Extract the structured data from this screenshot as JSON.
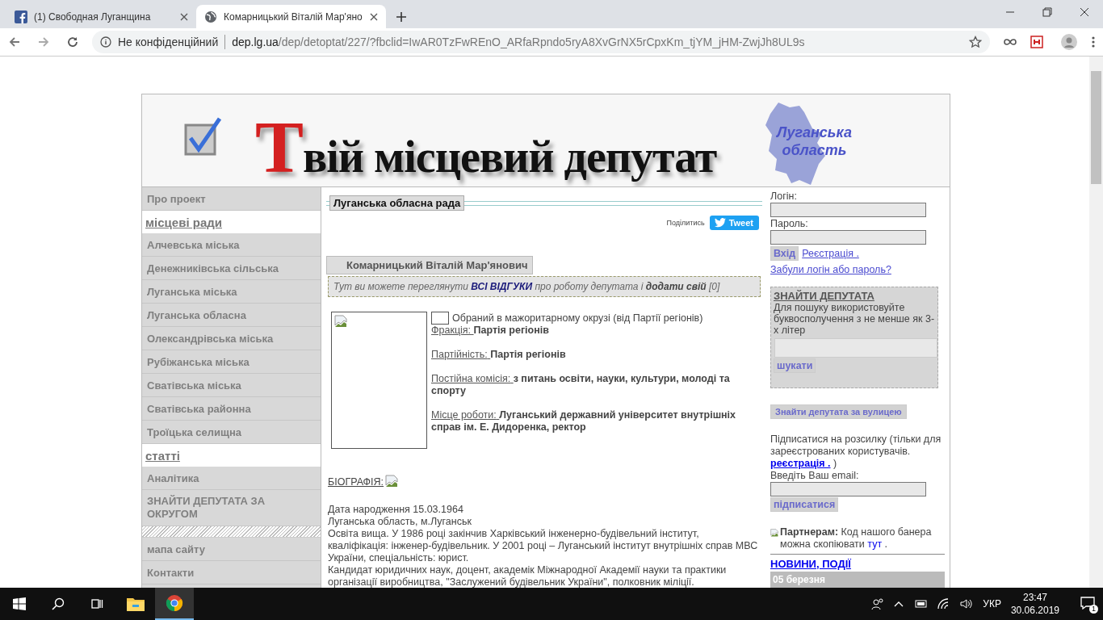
{
  "browser": {
    "tabs": [
      {
        "title": "(1) Свободная Луганщина",
        "selected": false,
        "kind": "facebook"
      },
      {
        "title": "Комарницький Віталій Мар'яно",
        "selected": true,
        "kind": "globe"
      }
    ],
    "security": "Не конфіденційний",
    "host": "dep.lg.ua",
    "path": "/dep/detoptat/227/?fbclid=IwAR0TzFwREnO_ARfaRpndo5ryA8XvGrNX5rCpxKm_tjYM_jHM-ZwjJh8UL9s"
  },
  "header": {
    "title_initial": "Т",
    "title_rest": "вій місцевий депутат",
    "region": [
      "Луганська",
      "область"
    ]
  },
  "sidebar": [
    {
      "kind": "item",
      "label": "Про проект"
    },
    {
      "kind": "section",
      "label": "місцеві ради"
    },
    {
      "kind": "item",
      "label": "Алчевська міська"
    },
    {
      "kind": "item",
      "label": "Денежниківська сільська"
    },
    {
      "kind": "item",
      "label": "Луганська міська"
    },
    {
      "kind": "item",
      "label": "Луганська обласна"
    },
    {
      "kind": "item",
      "label": "Олександрівська міська"
    },
    {
      "kind": "item",
      "label": "Рубіжанська міська"
    },
    {
      "kind": "item",
      "label": "Сватівська міська"
    },
    {
      "kind": "item",
      "label": "Сватівська районна"
    },
    {
      "kind": "item",
      "label": "Троїцька селищна"
    },
    {
      "kind": "section",
      "label": "статті"
    },
    {
      "kind": "item",
      "label": "Аналітика"
    },
    {
      "kind": "item",
      "label": "ЗНАЙТИ ДЕПУТАТА ЗА ОКРУГОМ"
    },
    {
      "kind": "hatch"
    },
    {
      "kind": "item",
      "label": "мапа сайту"
    },
    {
      "kind": "item",
      "label": "Контакти"
    }
  ],
  "content": {
    "council": "Луганська обласна рада",
    "share_label": "Поділитись",
    "tweet": "Tweet",
    "deputy_name": "Комарницький Віталій Мар'янович",
    "reviews": {
      "before": "Тут ви можете переглянути",
      "all_link": "ВСІ ВІДГУКИ",
      "middle": "про роботу депутата і",
      "add_link": "додати свій",
      "count": "[0]"
    },
    "elected": "Обраний в мажоритарному окрузі (від Партії регіонів)",
    "facts": [
      {
        "label": "Фракція:",
        "value": "Партія регіонів"
      },
      {
        "label": "Партійність:",
        "value": "Партія регіонів"
      },
      {
        "label": "Постійна комісія:",
        "value": "з питань освіти, науки, культури, молоді та спорту"
      },
      {
        "label": "Місце роботи:",
        "value": "Луганський державний університет внутрішніх справ ім. Е. Дидоренка, ректор"
      }
    ],
    "biography_heading": "БІОГРАФІЯ:",
    "biography": [
      "Дата народження 15.03.1964",
      "Луганська область, м.Луганськ",
      "Освіта вища. У 1986 році закінчив Харківський інженерно-будівельний інститут, кваліфікація: інженер-будівельник. У 2001 році – Луганський інститут внутрішніх справ МВС України, спеціальність: юрист.",
      "Кандидат юридичних наук, доцент, академік Міжнародної Академії науки та практики організації виробництва,  \"Заслужений будівельник України\", полковник міліції."
    ]
  },
  "right": {
    "login_label": "Логін:",
    "password_label": "Пароль:",
    "submit": "Вхід",
    "register": "Реєстрація .",
    "forgot": "Забули логін або пароль?",
    "search": {
      "title": "ЗНАЙТИ ДЕПУТАТА",
      "hint": "Для пошуку використовуйте буквосполучення з не менше як 3-х літер",
      "button": "шукати"
    },
    "street_button": "Знайти депутата за вулицею",
    "subscribe": {
      "text": "Підписатися на розсилку (тільки для зареєстрованих користувачів.",
      "link": "реєстрація .",
      "close": ")",
      "email_label": "Введіть Ваш email:",
      "button": "підписатися"
    },
    "partners": {
      "text": "**Партнерам:** Код нашого банера можна скопіювати",
      "link": "тут",
      "end": "."
    },
    "news": {
      "title": "НОВИНИ, ПОДІЇ",
      "date": "05 березня"
    }
  },
  "taskbar": {
    "lang": "УКР",
    "time": "23:47",
    "date": "30.06.2019",
    "notifications": "1"
  }
}
